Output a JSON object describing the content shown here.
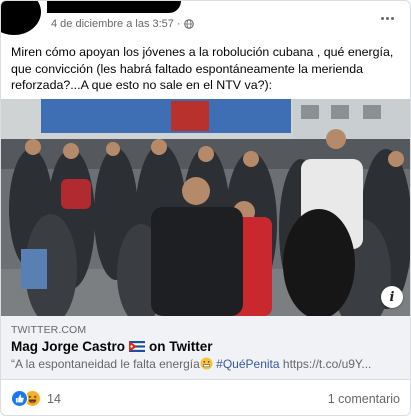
{
  "post": {
    "timestamp": "4 de diciembre a las 3:57",
    "separator": "·",
    "privacy_icon": "globe-icon",
    "more_icon": "more-options-icon",
    "text": "Miren cómo apoyan los jóvenes a la robolución cubana , qué energía, que convicción (les habrá faltado espontáneamente la merienda reforzada?...A que esto no sale en el NTV va?):"
  },
  "link_preview": {
    "domain": "TWITTER.COM",
    "title": "Mag Jorge Castro",
    "title_flag_icon": "cuba-flag-icon",
    "title_suffix": "on Twitter",
    "desc_text": "“A la espontaneidad le falta energía",
    "desc_emoji_icon": "grimacing-emoji-icon",
    "desc_hashtag": "#QuéPenita",
    "desc_url": "https://t.co/u9Y..."
  },
  "footer": {
    "reaction_icons": [
      "like-icon",
      "haha-icon"
    ],
    "reaction_count": "14",
    "comments": "1 comentario"
  },
  "colors": {
    "secondary_text": "#65676b",
    "link_bg": "#f0f2f5",
    "like_blue": "#1877f2",
    "haha_yellow": "#f7b125",
    "hashtag": "#385898"
  }
}
